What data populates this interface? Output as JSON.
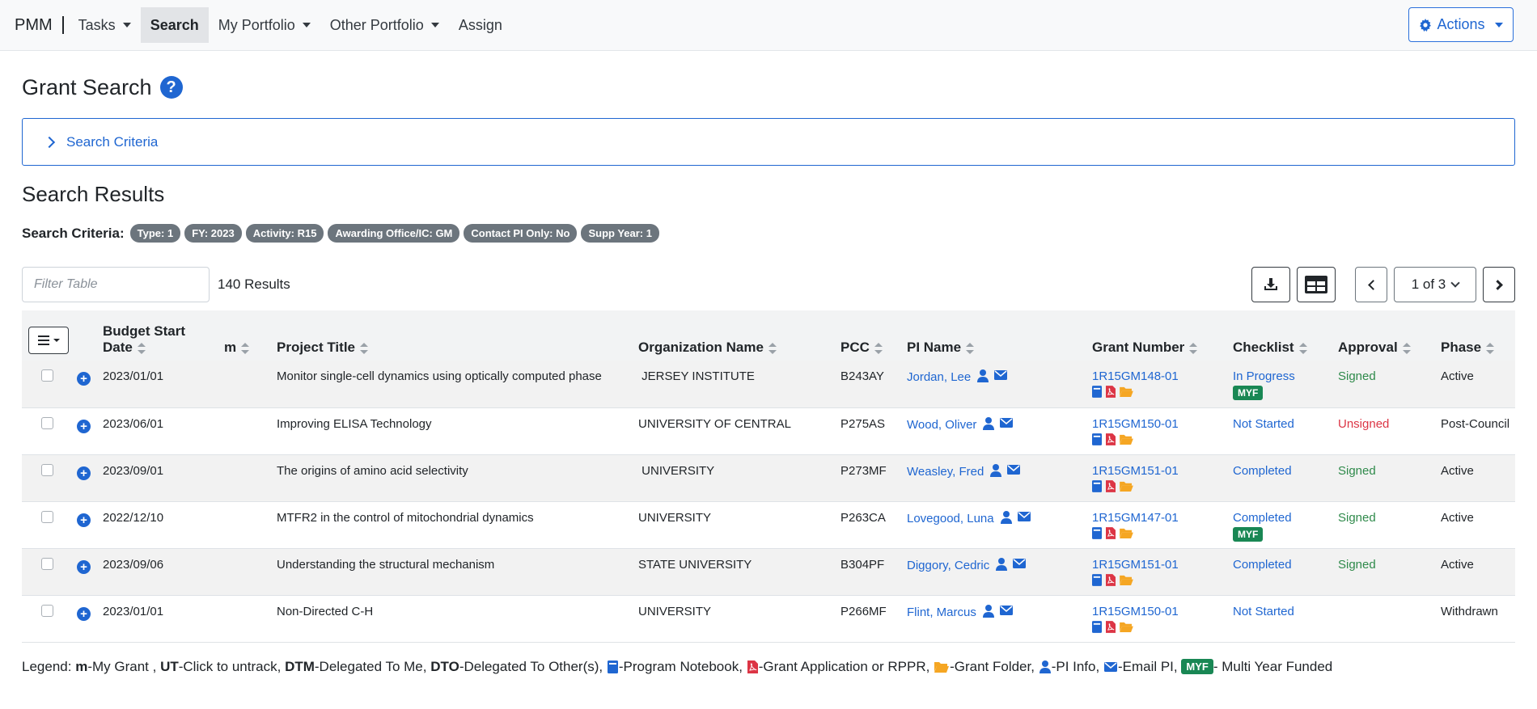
{
  "nav": {
    "brand": "PMM",
    "items": [
      {
        "label": "Tasks",
        "dropdown": true
      },
      {
        "label": "Search",
        "dropdown": false,
        "active": true
      },
      {
        "label": "My Portfolio",
        "dropdown": true
      },
      {
        "label": "Other Portfolio",
        "dropdown": true
      },
      {
        "label": "Assign",
        "dropdown": false
      }
    ],
    "actions_label": "Actions"
  },
  "page": {
    "title": "Grant Search",
    "search_criteria_toggle": "Search Criteria",
    "results_title": "Search Results",
    "criteria_label": "Search Criteria:",
    "chips": [
      "Type: 1",
      "FY: 2023",
      "Activity: R15",
      "Awarding Office/IC: GM",
      "Contact PI Only: No",
      "Supp Year: 1"
    ]
  },
  "toolbar": {
    "filter_placeholder": "Filter Table",
    "result_count": "140 Results",
    "pager": "1 of 3"
  },
  "table": {
    "headers": {
      "budget_start": "Budget Start Date",
      "m": "m",
      "title": "Project Title",
      "org": "Organization Name",
      "pcc": "PCC",
      "pi": "PI Name",
      "grant": "Grant Number",
      "checklist": "Checklist",
      "approval": "Approval",
      "phase": "Phase"
    },
    "rows": [
      {
        "date": "2023/01/01",
        "title": "Monitor single-cell dynamics using optically computed phase",
        "org": " JERSEY INSTITUTE",
        "pcc": "B243AY",
        "pi": "Jordan, Lee",
        "grant": "1R15GM148-01",
        "checklist": "In Progress",
        "myf": true,
        "approval": "Signed",
        "approval_status": "signed",
        "phase": "Active"
      },
      {
        "date": "2023/06/01",
        "title": "Improving ELISA Technology",
        "org": "UNIVERSITY OF CENTRAL",
        "pcc": "P275AS",
        "pi": "Wood, Oliver",
        "grant": "1R15GM150-01",
        "checklist": "Not Started",
        "myf": false,
        "approval": "Unsigned",
        "approval_status": "unsigned",
        "phase": "Post-Council"
      },
      {
        "date": "2023/09/01",
        "title": "The origins of amino acid selectivity",
        "org": " UNIVERSITY",
        "pcc": "P273MF",
        "pi": "Weasley, Fred",
        "grant": "1R15GM151-01",
        "checklist": "Completed",
        "myf": false,
        "approval": "Signed",
        "approval_status": "signed",
        "phase": "Active"
      },
      {
        "date": "2022/12/10",
        "title": "MTFR2 in the control of mitochondrial dynamics",
        "org": "UNIVERSITY",
        "pcc": "P263CA",
        "pi": "Lovegood, Luna",
        "grant": "1R15GM147-01",
        "checklist": "Completed",
        "myf": true,
        "approval": "Signed",
        "approval_status": "signed",
        "phase": "Active"
      },
      {
        "date": "2023/09/06",
        "title": "Understanding the structural mechanism",
        "org": "STATE UNIVERSITY",
        "pcc": "B304PF",
        "pi": "Diggory, Cedric",
        "grant": "1R15GM151-01",
        "checklist": "Completed",
        "myf": false,
        "approval": "Signed",
        "approval_status": "signed",
        "phase": "Active"
      },
      {
        "date": "2023/01/01",
        "title": "Non-Directed C-H",
        "org": "UNIVERSITY",
        "pcc": "P266MF",
        "pi": "Flint, Marcus",
        "grant": "1R15GM150-01",
        "checklist": "Not Started",
        "myf": false,
        "approval": "",
        "approval_status": "none",
        "phase": "Withdrawn"
      }
    ],
    "myf_label": "MYF"
  },
  "legend": {
    "prefix": "Legend: ",
    "m_key": "m",
    "m_text": "-My Grant , ",
    "ut_key": "UT",
    "ut_text": "-Click to untrack, ",
    "dtm_key": "DTM",
    "dtm_text": "-Delegated To Me, ",
    "dto_key": "DTO",
    "dto_text": "-Delegated To Other(s), ",
    "notebook_text": "-Program Notebook, ",
    "pdf_text": "-Grant Application or RPPR, ",
    "folder_text": "-Grant Folder, ",
    "pi_text": "-PI Info, ",
    "email_text": "-Email PI, ",
    "myf_label": "MYF",
    "myf_text": " - Multi Year Funded"
  },
  "colors": {
    "primary": "#1f66d1",
    "signed": "#2f8a4b",
    "unsigned": "#dc3545",
    "myf": "#198754",
    "chip": "#6c757d",
    "pdf": "#dc3545",
    "folder": "#f5a623"
  }
}
